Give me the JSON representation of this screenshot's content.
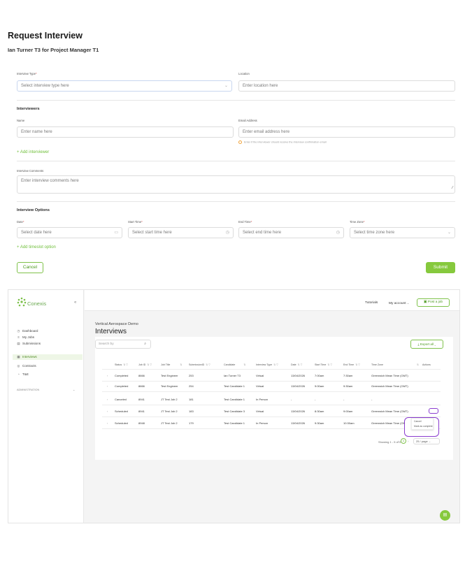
{
  "request": {
    "title": "Request Interview",
    "subtitle": "Ian Turner T3 for Project Manager T1",
    "interview_type": {
      "label": "Interview Type",
      "placeholder": "Select interview type here"
    },
    "location": {
      "label": "Location",
      "placeholder": "Enter location here"
    },
    "interviewers_heading": "Interviewers",
    "name": {
      "label": "Name",
      "placeholder": "Enter name here"
    },
    "email": {
      "label": "Email Address",
      "placeholder": "Enter email address here",
      "hint": "Enter if the interviewer should receive the interview confirmation email"
    },
    "add_interviewer": "+ Add interviewer",
    "comments": {
      "label": "Interview Comments",
      "placeholder": "Enter interview comments here"
    },
    "options_heading": "Interview Options",
    "date": {
      "label": "Date",
      "placeholder": "Select date here"
    },
    "start_time": {
      "label": "Start Time",
      "placeholder": "Select start time here"
    },
    "end_time": {
      "label": "End Time",
      "placeholder": "Select end time here"
    },
    "time_zone": {
      "label": "Time Zone",
      "placeholder": "Select time zone here"
    },
    "add_timeslot": "+ Add timeslot option",
    "cancel": "Cancel",
    "submit": "Submit",
    "req_mark": "*"
  },
  "app": {
    "logo": "Conexis",
    "collapse": "«",
    "nav": [
      {
        "label": "Dashboard",
        "icon": "clock-icon"
      },
      {
        "label": "My Jobs",
        "icon": "list-icon"
      },
      {
        "label": "Submissions",
        "icon": "doc-icon"
      },
      {
        "label": "Interviews",
        "icon": "calendar-icon"
      },
      {
        "label": "Contracts",
        "icon": "contract-icon"
      },
      {
        "label": "T&E",
        "icon": "timer-icon"
      }
    ],
    "admin": "ADMINISTRATION",
    "topbar": {
      "tutorials": "Tutorials",
      "account": "My account",
      "post": "Post a job"
    },
    "company": "Vertical Aerospace Demo",
    "page_title": "Interviews",
    "search_placeholder": "Search by",
    "export": "Export all",
    "columns": [
      "Status",
      "Job ID",
      "Job Title",
      "SubmissionID",
      "Candidate",
      "Interview Type",
      "Date",
      "Start Time",
      "End Time",
      "Time Zone",
      "Actions"
    ],
    "rows": [
      [
        "Completed",
        "8666",
        "Test Engineer",
        "253",
        "Ian Turner T3",
        "Virtual",
        "13/04/2026",
        "7:00am",
        "7:30am",
        "Greenwich Mean Time (GMT)"
      ],
      [
        "Completed",
        "8666",
        "Test Engineer",
        "254",
        "Test Candidate 1",
        "Virtual",
        "13/04/2026",
        "9:00am",
        "9:30am",
        "Greenwich Mean Time (GMT)"
      ],
      [
        "Canceled",
        "8941",
        "JT Test Job 2",
        "181",
        "Test Candidate 1",
        "In Person",
        "-",
        "-",
        "-",
        "-"
      ],
      [
        "Scheduled",
        "8941",
        "JT Test Job 2",
        "183",
        "Test Candidate 3",
        "Virtual",
        "13/04/2026",
        "8:30am",
        "9:00am",
        "Greenwich Mean Time (GMT)"
      ],
      [
        "Scheduled",
        "8948",
        "JT Test Job 2",
        "179",
        "Test Candidate 1",
        "In Person",
        "13/04/2026",
        "9:30am",
        "10:30am",
        "Greenwich Mean Time (GMT)"
      ]
    ],
    "menu": [
      "Cancel",
      "Mark as complete"
    ],
    "pager": {
      "info": "Showing 1 - 5 of 5",
      "prev": "‹",
      "current": "1",
      "next": "›",
      "size": "25 / page"
    },
    "colors": {
      "accent": "#86c93d",
      "highlight": "#8a3ccf"
    }
  }
}
